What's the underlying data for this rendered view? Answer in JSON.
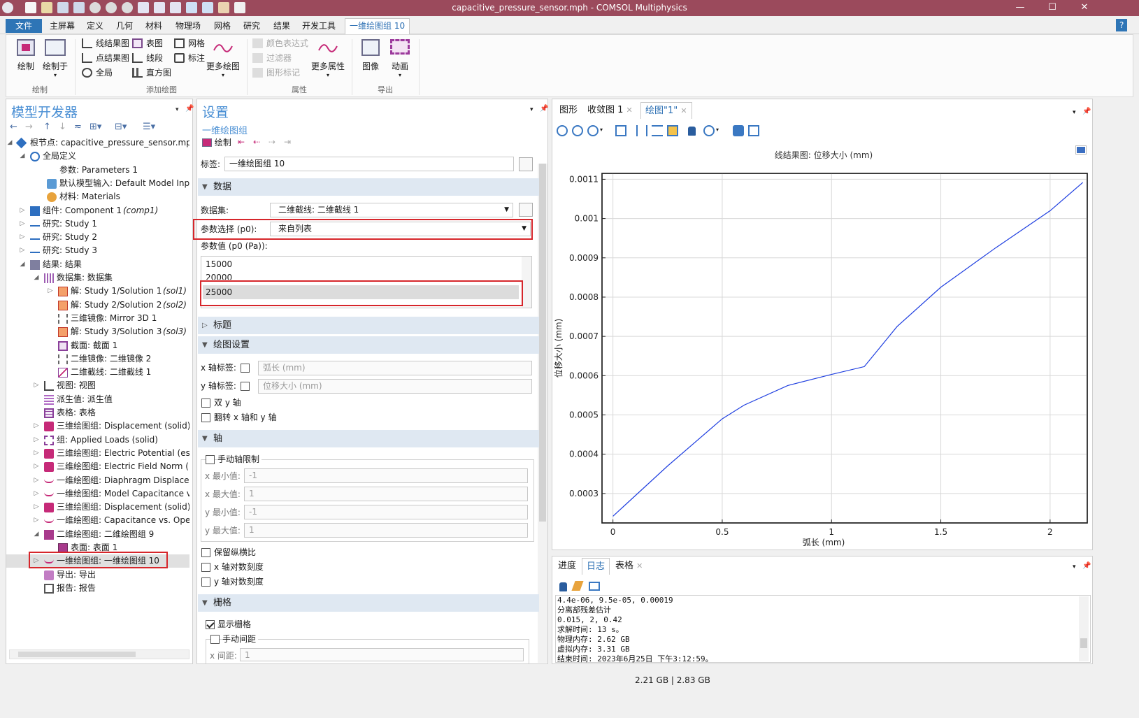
{
  "window": {
    "title": "capacitive_pressure_sensor.mph - COMSOL Multiphysics",
    "help": "?"
  },
  "menu": {
    "tabs": [
      "文件",
      "主屏幕",
      "定义",
      "几何",
      "材料",
      "物理场",
      "网格",
      "研究",
      "结果",
      "开发工具",
      "一维绘图组 10"
    ]
  },
  "ribbon": {
    "plot": "绘制",
    "plot_in": "绘制于",
    "line_graph": "线结果图",
    "point_graph": "点结果图",
    "global": "全局",
    "table": "表图",
    "line_seg": "线段",
    "histogram": "直方图",
    "mesh": "网格",
    "annotation": "标注",
    "more_plots": "更多绘图",
    "color_expr": "颜色表达式",
    "filter": "过滤器",
    "graph_marker": "图形标记",
    "more_attr": "更多属性",
    "image": "图像",
    "animation": "动画",
    "grp_plot": "绘制",
    "grp_add": "添加绘图",
    "grp_attr": "属性",
    "grp_export": "导出"
  },
  "model_builder": {
    "title": "模型开发器",
    "tree": [
      {
        "label": "根节点: capacitive_pressure_sensor.mph",
        "italic": ""
      },
      {
        "label": "全局定义",
        "italic": ""
      },
      {
        "label": "参数: Parameters 1",
        "italic": ""
      },
      {
        "label": "默认模型输入: Default Model Inp",
        "italic": ""
      },
      {
        "label": "材料: Materials",
        "italic": ""
      },
      {
        "label": "组件: Component 1 ",
        "italic": "(comp1)"
      },
      {
        "label": "研究: Study 1",
        "italic": ""
      },
      {
        "label": "研究: Study 2",
        "italic": ""
      },
      {
        "label": "研究: Study 3",
        "italic": ""
      },
      {
        "label": "结果: 结果",
        "italic": ""
      },
      {
        "label": "数据集: 数据集",
        "italic": ""
      },
      {
        "label": "解: Study 1/Solution 1 ",
        "italic": "(sol1)"
      },
      {
        "label": "解: Study 2/Solution 2 ",
        "italic": "(sol2)"
      },
      {
        "label": "三维镜像: Mirror 3D 1",
        "italic": ""
      },
      {
        "label": "解: Study 3/Solution 3 ",
        "italic": "(sol3)"
      },
      {
        "label": "截面: 截面 1",
        "italic": ""
      },
      {
        "label": "二维镜像: 二维镜像 2",
        "italic": ""
      },
      {
        "label": "二维截线: 二维截线 1",
        "italic": ""
      },
      {
        "label": "视图: 视图",
        "italic": ""
      },
      {
        "label": "派生值: 派生值",
        "italic": ""
      },
      {
        "label": "表格: 表格",
        "italic": ""
      },
      {
        "label": "三维绘图组: Displacement (solid)",
        "italic": ""
      },
      {
        "label": "组: Applied Loads (solid)",
        "italic": ""
      },
      {
        "label": "三维绘图组: Electric Potential (es)",
        "italic": ""
      },
      {
        "label": "三维绘图组: Electric Field Norm (",
        "italic": ""
      },
      {
        "label": "一维绘图组: Diaphragm Displace",
        "italic": ""
      },
      {
        "label": "一维绘图组: Model Capacitance v",
        "italic": ""
      },
      {
        "label": "三维绘图组: Displacement (solid)",
        "italic": ""
      },
      {
        "label": "一维绘图组: Capacitance vs. Ope",
        "italic": ""
      },
      {
        "label": "二维绘图组: 二维绘图组 9",
        "italic": ""
      },
      {
        "label": "表面: 表面 1",
        "italic": ""
      },
      {
        "label": "一维绘图组: 一维绘图组 10",
        "italic": ""
      },
      {
        "label": "导出: 导出",
        "italic": ""
      },
      {
        "label": "报告: 报告",
        "italic": ""
      }
    ]
  },
  "settings": {
    "title": "设置",
    "subtitle": "一维绘图组",
    "plot_btn": "绘制",
    "label_lbl": "标签:",
    "label_val": "一维绘图组 10",
    "sec_data": "数据",
    "dataset_lbl": "数据集:",
    "dataset_val": "二维截线: 二维截线 1",
    "param_sel_lbl": "参数选择 (p0):",
    "param_sel_val": "来自列表",
    "param_vals_lbl": "参数值 (p0 (Pa)):",
    "param_vals": [
      "15000",
      "20000",
      "25000"
    ],
    "sec_title": "标题",
    "sec_plot": "绘图设置",
    "xlabel_lbl": "x 轴标签:",
    "xlabel_ph": "弧长 (mm)",
    "ylabel_lbl": "y 轴标签:",
    "ylabel_ph": "位移大小 (mm)",
    "dual_y": "双 y 轴",
    "flip": "翻转 x 轴和 y 轴",
    "sec_axis": "轴",
    "manual_limits": "手动轴限制",
    "xmin_lbl": "x 最小值:",
    "xmin": "-1",
    "xmax_lbl": "x 最大值:",
    "xmax": "1",
    "ymin_lbl": "y 最小值:",
    "ymin": "-1",
    "ymax_lbl": "y 最大值:",
    "ymax": "1",
    "keep_aspect": "保留纵横比",
    "xlog": "x 轴对数刻度",
    "ylog": "y 轴对数刻度",
    "sec_grid": "栅格",
    "show_grid": "显示栅格",
    "manual_spacing": "手动间距",
    "xspacing_lbl": "x 间距:",
    "xspacing": "1"
  },
  "graphics": {
    "tabs": [
      "图形",
      "收敛图 1",
      "绘图\"1\""
    ]
  },
  "chart_data": {
    "type": "line",
    "title": "线结果图: 位移大小 (mm)",
    "xlabel": "弧长 (mm)",
    "ylabel": "位移大小 (mm)",
    "xlim": [
      -0.05,
      2.17
    ],
    "ylim": [
      0.000225,
      0.001115
    ],
    "xticks": [
      "0",
      "0.5",
      "1",
      "1.5",
      "2"
    ],
    "yticks": [
      "0.0003",
      "0.0004",
      "0.0005",
      "0.0006",
      "0.0007",
      "0.0008",
      "0.0009",
      "0.001",
      "0.0011"
    ],
    "grid": true,
    "series": [
      {
        "color": "#1f3fe0",
        "x": [
          0,
          0.25,
          0.5,
          0.6,
          0.8,
          1.0,
          1.15,
          1.3,
          1.5,
          1.75,
          2.0,
          2.15
        ],
        "y": [
          0.000242,
          0.00037,
          0.00049,
          0.000525,
          0.000575,
          0.000603,
          0.000623,
          0.000725,
          0.000825,
          0.000925,
          0.00102,
          0.001092
        ]
      }
    ]
  },
  "messages": {
    "tabs": [
      "进度",
      "日志",
      "表格"
    ],
    "log": [
      "4.4e-06, 9.5e-05, 0.00019",
      "分离部残差估计",
      "0.015, 2, 0.42",
      "求解时间: 13 s。",
      "物理内存: 2.62 GB",
      "虚拟内存: 3.31 GB",
      "结束时间: 2023年6月25日 下午3:12:59。"
    ]
  },
  "status": {
    "memory": "2.21 GB | 2.83 GB"
  }
}
